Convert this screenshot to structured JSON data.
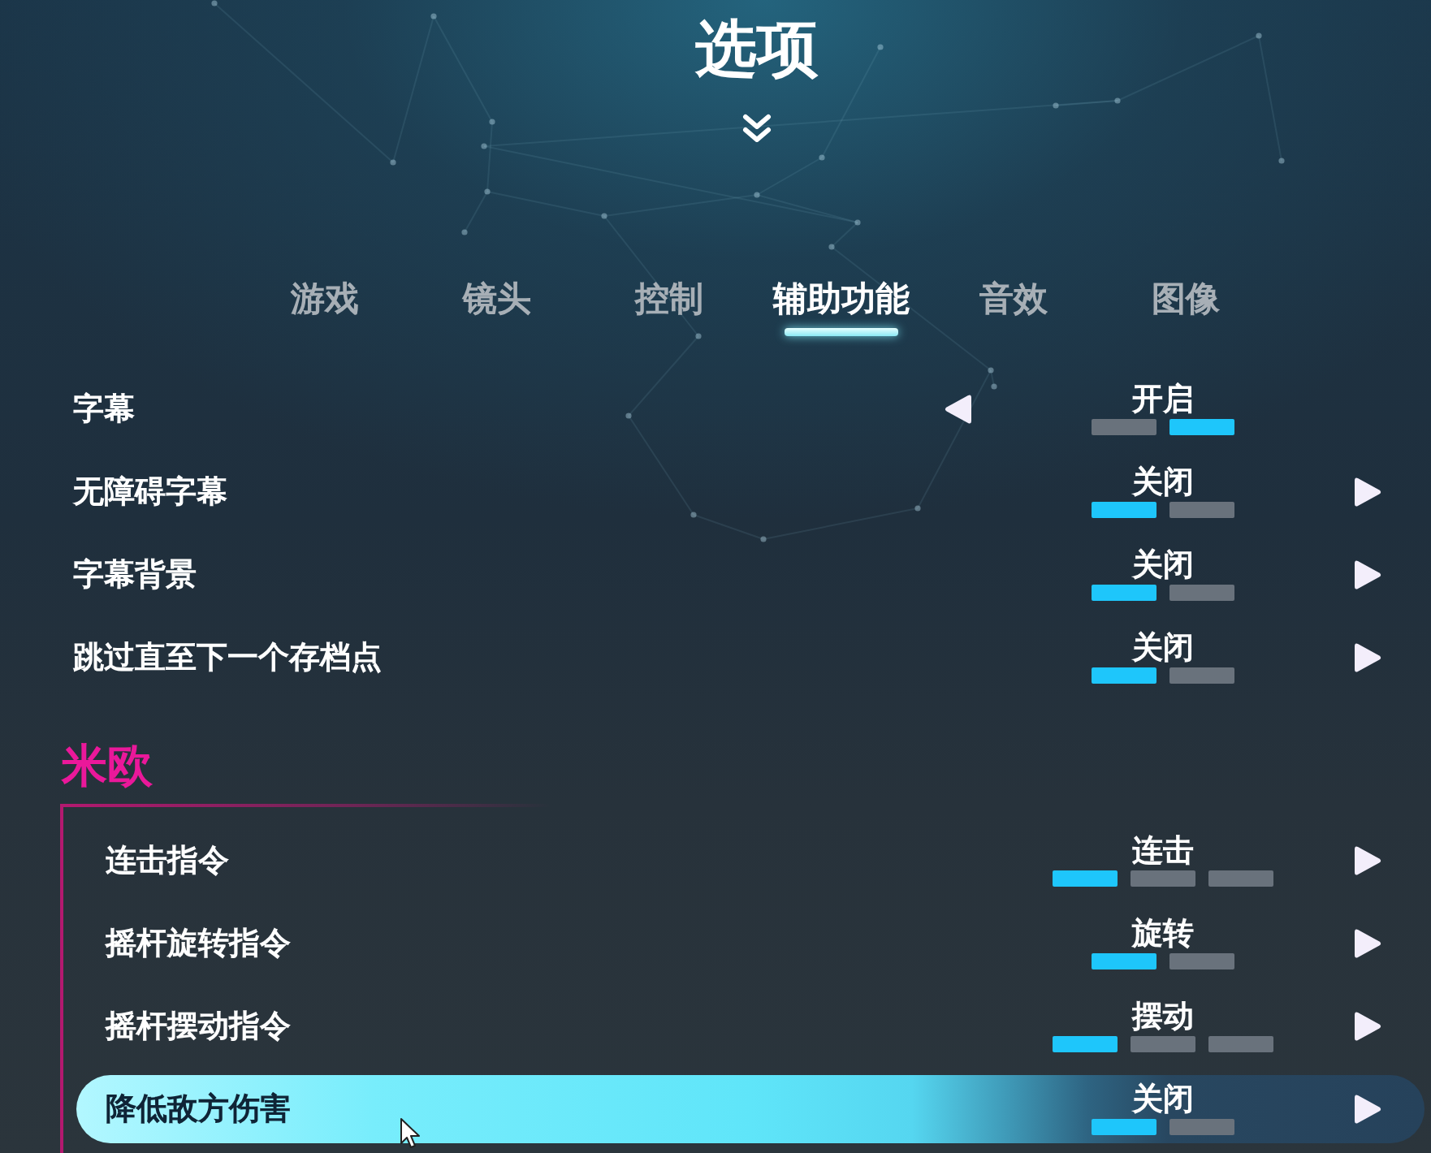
{
  "header": {
    "title": "选项"
  },
  "tabs": [
    {
      "label": "游戏",
      "selected": false
    },
    {
      "label": "镜头",
      "selected": false
    },
    {
      "label": "控制",
      "selected": false
    },
    {
      "label": "辅助功能",
      "selected": true
    },
    {
      "label": "音效",
      "selected": false
    },
    {
      "label": "图像",
      "selected": false
    }
  ],
  "settings": [
    {
      "label": "字幕",
      "value": "开启",
      "selected": false,
      "segments": [
        {
          "selected": false
        },
        {
          "selected": true
        }
      ]
    },
    {
      "label": "无障碍字幕",
      "value": "关闭",
      "selected": false,
      "segments": [
        {
          "selected": true
        },
        {
          "selected": false
        }
      ]
    },
    {
      "label": "字幕背景",
      "value": "关闭",
      "selected": false,
      "segments": [
        {
          "selected": true
        },
        {
          "selected": false
        }
      ]
    },
    {
      "label": "跳过直至下一个存档点",
      "value": "关闭",
      "selected": false,
      "segments": [
        {
          "selected": true
        },
        {
          "selected": false
        }
      ]
    }
  ],
  "section": {
    "title": "米欧",
    "settings": [
      {
        "label": "连击指令",
        "value": "连击",
        "selected": false,
        "segments": [
          {
            "selected": true
          },
          {
            "selected": false
          },
          {
            "selected": false
          }
        ]
      },
      {
        "label": "摇杆旋转指令",
        "value": "旋转",
        "selected": false,
        "segments": [
          {
            "selected": true
          },
          {
            "selected": false
          }
        ]
      },
      {
        "label": "摇杆摆动指令",
        "value": "摆动",
        "selected": false,
        "segments": [
          {
            "selected": true
          },
          {
            "selected": false
          },
          {
            "selected": false
          }
        ]
      },
      {
        "label": "降低敌方伤害",
        "value": "关闭",
        "selected": true,
        "segments": [
          {
            "selected": true
          },
          {
            "selected": false
          }
        ]
      }
    ]
  }
}
